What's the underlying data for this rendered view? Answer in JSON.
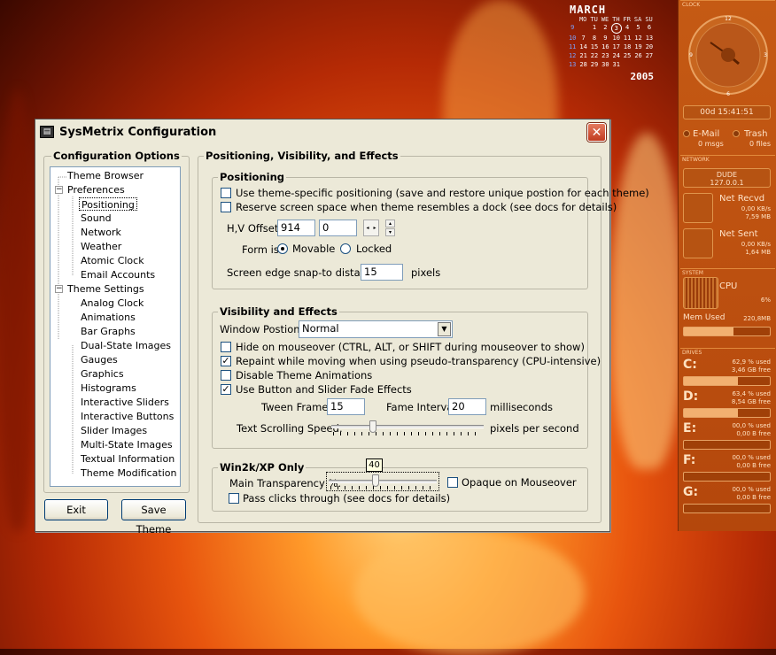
{
  "calendar": {
    "month": "MARCH",
    "days_of_week": [
      "MO",
      "TU",
      "WE",
      "TH",
      "FR",
      "SA",
      "SU"
    ],
    "rows": [
      [
        "9",
        "",
        "1",
        "2",
        "3",
        "4",
        "5",
        "6"
      ],
      [
        "10",
        "7",
        "8",
        "9",
        "10",
        "11",
        "12",
        "13"
      ],
      [
        "11",
        "14",
        "15",
        "16",
        "17",
        "18",
        "19",
        "20"
      ],
      [
        "12",
        "21",
        "22",
        "23",
        "24",
        "25",
        "26",
        "27"
      ],
      [
        "13",
        "28",
        "29",
        "30",
        "31",
        "",
        "",
        ""
      ]
    ],
    "year": "2005",
    "today": "3"
  },
  "panel": {
    "clock_label": "CLOCK",
    "clock_time": "00d 15:41:51",
    "email_label": "E-Mail",
    "email_value": "0 msgs",
    "trash_label": "Trash",
    "trash_value": "0 files",
    "network_label": "NETWORK",
    "net_host": "DUDE",
    "net_ip": "127.0.0.1",
    "net_recv_label": "Net Recvd",
    "net_recv_rate": "0,00 KB/s",
    "net_recv_total": "7,59 MB",
    "net_sent_label": "Net Sent",
    "net_sent_rate": "0,00 KB/s",
    "net_sent_total": "1,64 MB",
    "system_label": "SYSTEM",
    "cpu_label": "CPU",
    "cpu_value": "6%",
    "mem_label": "Mem Used",
    "mem_value": "220,8MB",
    "mem_fraction": 0.58,
    "drives_label": "DRIVES",
    "drives": [
      {
        "letter": "C:",
        "used": "62,9 % used",
        "free": "3,46 GB free",
        "fraction": 0.63
      },
      {
        "letter": "D:",
        "used": "63,4 % used",
        "free": "8,54 GB free",
        "fraction": 0.634
      },
      {
        "letter": "E:",
        "used": "00,0 % used",
        "free": "0,00 B free",
        "fraction": 0
      },
      {
        "letter": "F:",
        "used": "00,0 % used",
        "free": "0,00 B free",
        "fraction": 0
      },
      {
        "letter": "G:",
        "used": "00,0 % used",
        "free": "0,00 B free",
        "fraction": 0
      }
    ]
  },
  "window": {
    "title": "SysMetrix Configuration",
    "close": "✕",
    "options_title": "Configuration Options",
    "tree": [
      {
        "label": "Theme Browser"
      },
      {
        "label": "Preferences",
        "expander": "−"
      },
      {
        "label": "Positioning",
        "selected": true
      },
      {
        "label": "Sound"
      },
      {
        "label": "Network"
      },
      {
        "label": "Weather"
      },
      {
        "label": "Atomic Clock"
      },
      {
        "label": "Email Accounts"
      },
      {
        "label": "Theme Settings",
        "expander": "−"
      },
      {
        "label": "Analog Clock"
      },
      {
        "label": "Animations"
      },
      {
        "label": "Bar Graphs"
      },
      {
        "label": "Dual-State Images"
      },
      {
        "label": "Gauges"
      },
      {
        "label": "Graphics"
      },
      {
        "label": "Histograms"
      },
      {
        "label": "Interactive Sliders"
      },
      {
        "label": "Interactive Buttons"
      },
      {
        "label": "Slider Images"
      },
      {
        "label": "Multi-State Images"
      },
      {
        "label": "Textual Information"
      },
      {
        "label": "Theme Modification"
      }
    ],
    "exit_label": "Exit",
    "save_label": "Save Theme",
    "main_title": "Positioning, Visibility, and Effects",
    "positioning": {
      "title": "Positioning",
      "theme_specific": "Use theme-specific positioning (save and restore unique postion for each theme)",
      "reserve_space": "Reserve screen space when theme resembles a dock (see docs for details)",
      "offset_label": "H,V Offset:",
      "h_offset": "914",
      "v_offset": "0",
      "form_label": "Form is:",
      "movable": "Movable",
      "locked": "Locked",
      "snap_label": "Screen edge snap-to distance:",
      "snap_value": "15",
      "snap_unit": "pixels"
    },
    "visibility": {
      "title": "Visibility and Effects",
      "window_position_label": "Window Postion:",
      "window_position_value": "Normal",
      "hide_mouseover": "Hide on mouseover (CTRL, ALT, or SHIFT during mouseover to show)",
      "repaint": "Repaint while moving when using pseudo-transparency (CPU-intensive)",
      "disable_anim": "Disable Theme Animations",
      "fade_effects": "Use Button and Slider Fade Effects",
      "tween_label": "Tween Frames:",
      "tween_value": "15",
      "frame_label": "Fame Interval:",
      "frame_value": "20",
      "frame_unit": "milliseconds",
      "scroll_label": "Text Scrolling Speed:",
      "scroll_unit": "pixels per second",
      "scroll_fraction": 0.26
    },
    "win2k": {
      "title": "Win2k/XP Only",
      "transparency_label": "Main Transparency %:",
      "transparency_value": "40",
      "transparency_fraction": 0.43,
      "opaque": "Opaque on Mouseover",
      "pass_clicks": "Pass clicks through (see docs for details)"
    },
    "checked": {
      "theme_specific": false,
      "reserve_space": false,
      "hide_mouseover": false,
      "repaint": true,
      "disable_anim": false,
      "fade_effects": true,
      "opaque": false,
      "pass_clicks": false
    }
  }
}
